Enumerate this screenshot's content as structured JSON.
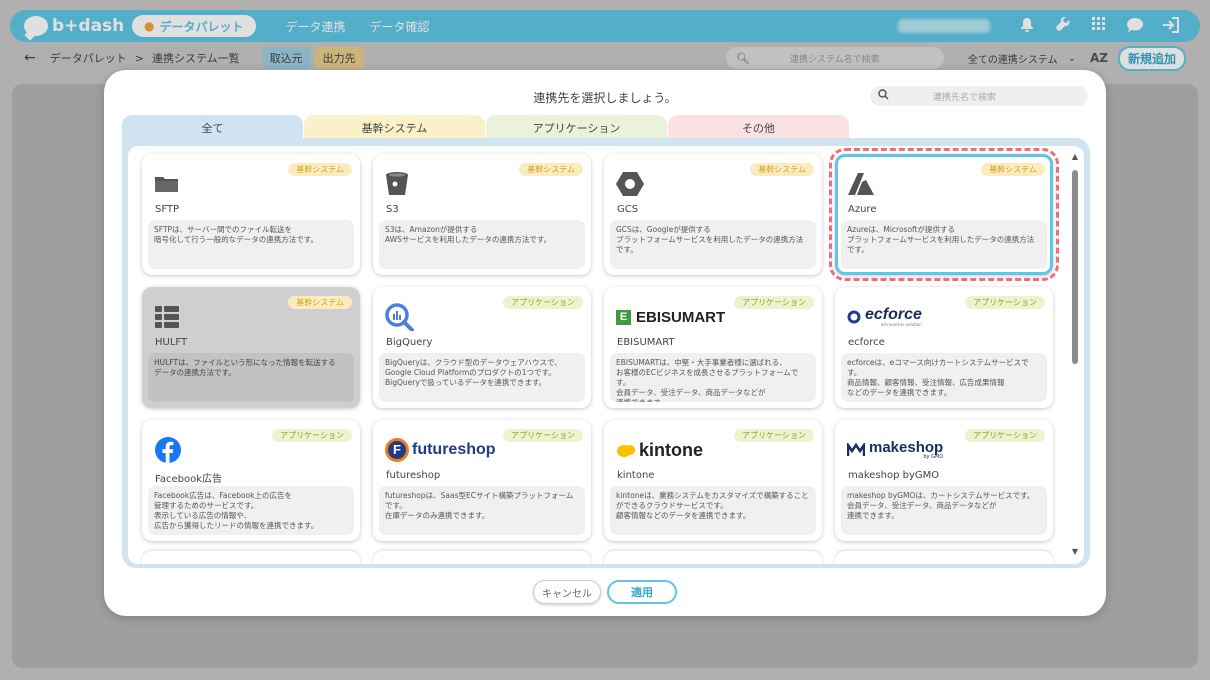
{
  "header": {
    "logo_text": "b+dash",
    "palette_label": "データパレット",
    "nav": [
      "データ連携",
      "データ確認"
    ]
  },
  "subbar": {
    "breadcrumb_root": "データパレット",
    "breadcrumb_sep": ">",
    "breadcrumb_current": "連携システム一覧",
    "tab_in": "取込元",
    "tab_out": "出力先",
    "search_placeholder": "連携システム名で検索",
    "filter_value": "全ての連携システム",
    "sort_label": "AZ",
    "new_button": "新規追加"
  },
  "modal": {
    "title": "連携先を選択しましょう。",
    "search_placeholder": "連携先名で検索",
    "tabs": [
      "全て",
      "基幹システム",
      "アプリケーション",
      "その他"
    ],
    "cancel_label": "キャンセル",
    "apply_label": "適用",
    "badges": {
      "core": "基幹システム",
      "app": "アプリケーション"
    },
    "cards": [
      {
        "name": "SFTP",
        "desc": "SFTPは、サーバー間でのファイル転送を\n暗号化して行う一般的なデータの連携方法です。"
      },
      {
        "name": "S3",
        "desc": "S3は、Amazonが提供する\nAWSサービスを利用したデータの連携方法です。"
      },
      {
        "name": "GCS",
        "desc": "GCSは、Googleが提供する\nプラットフォームサービスを利用したデータの連携方法\nです。"
      },
      {
        "name": "Azure",
        "desc": "Azureは、Microsoftが提供する\nプラットフォームサービスを利用したデータの連携方法\nです。"
      },
      {
        "name": "HULFT",
        "desc": "HULFTは、ファイルという形になった情報を転送する\nデータの連携方法です。"
      },
      {
        "name": "BigQuery",
        "desc": "BigQueryは、クラウド型のデータウェアハウスで、\nGoogle Cloud Platformのプロダクトの1つです。\nBigQueryで扱っているデータを連携できます。"
      },
      {
        "name": "EBISUMART",
        "logo_text": "EBISUMART",
        "desc": "EBISUMARTは、中堅・大手事業者様に選ばれる、\nお客様のECビジネスを成長させるプラットフォームです。\n会員データ、受注データ、商品データなどが\n連携できます。"
      },
      {
        "name": "ecforce",
        "logo_text": "ecforce",
        "logo_sub": "all-round ec solution",
        "desc": "ecforceは、eコマース向けカートシステムサービスです。\n商品情報、顧客情報、受注情報、広告成果情報\nなどのデータを連携できます。"
      },
      {
        "name": "Facebook広告",
        "desc": "Facebook広告は、Facebook上の広告を\n管理するためのサービスです。\n表示している広告の情報や、\n広告から獲得したリードの情報を連携できます。"
      },
      {
        "name": "futureshop",
        "logo_text": "futureshop",
        "desc": "futureshopは、Saas型ECサイト構築プラットフォーム\nです。\n在庫データのみ連携できます。"
      },
      {
        "name": "kintone",
        "logo_text": "kintone",
        "desc": "kintoneは、業務システムをカスタマイズで構築すること\nができるクラウドサービスです。\n顧客情報などのデータを連携できます。"
      },
      {
        "name": "makeshop byGMO",
        "logo_text": "makeshop",
        "logo_sub": "by GMO",
        "desc": "makeshop byGMOは、カートシステムサービスです。\n会員データ、受注データ、商品データなどが\n連携できます。"
      }
    ]
  },
  "colors": {
    "accent": "#5fc6e6",
    "selected_outline": "#ee6e7a",
    "core_badge": "#fbecc0",
    "app_badge": "#eef3cf"
  }
}
